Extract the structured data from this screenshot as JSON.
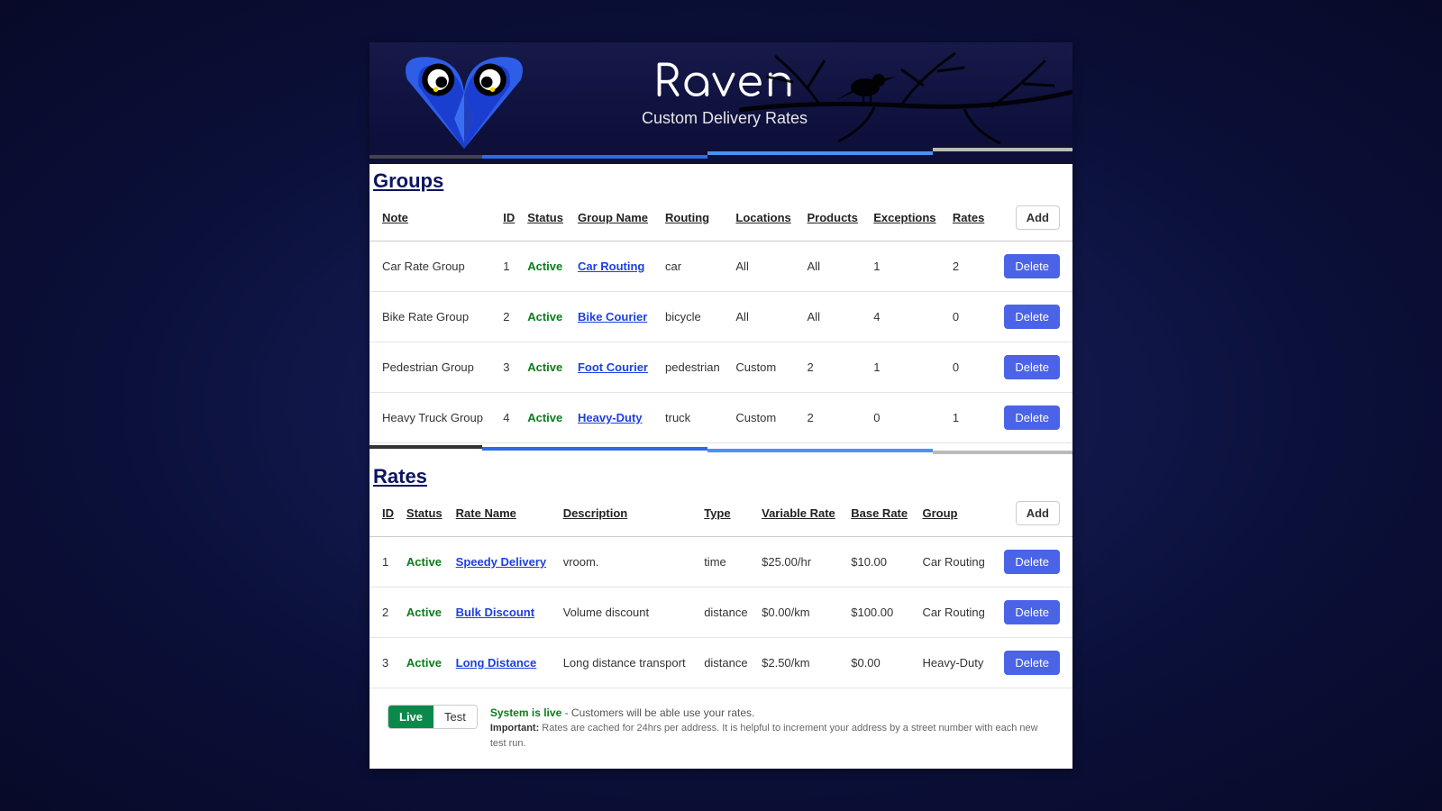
{
  "brand": {
    "name": "Raven",
    "subtitle": "Custom Delivery Rates"
  },
  "sections": {
    "groups": "Groups",
    "rates": "Rates"
  },
  "buttons": {
    "add": "Add",
    "delete": "Delete"
  },
  "groups": {
    "headers": [
      "Note",
      "ID",
      "Status",
      "Group Name",
      "Routing",
      "Locations",
      "Products",
      "Exceptions",
      "Rates",
      ""
    ],
    "rows": [
      {
        "note": "Car Rate Group",
        "id": "1",
        "status": "Active",
        "name": "Car Routing",
        "routing": "car",
        "locations": "All",
        "products": "All",
        "exceptions": "1",
        "rates": "2"
      },
      {
        "note": "Bike Rate Group",
        "id": "2",
        "status": "Active",
        "name": "Bike Courier",
        "routing": "bicycle",
        "locations": "All",
        "products": "All",
        "exceptions": "4",
        "rates": "0"
      },
      {
        "note": "Pedestrian Group",
        "id": "3",
        "status": "Active",
        "name": "Foot Courier",
        "routing": "pedestrian",
        "locations": "Custom",
        "products": "2",
        "exceptions": "1",
        "rates": "0"
      },
      {
        "note": "Heavy Truck Group",
        "id": "4",
        "status": "Active",
        "name": "Heavy-Duty",
        "routing": "truck",
        "locations": "Custom",
        "products": "2",
        "exceptions": "0",
        "rates": "1"
      }
    ]
  },
  "ratesTable": {
    "headers": [
      "ID",
      "Status",
      "Rate Name",
      "Description",
      "Type",
      "Variable Rate",
      "Base Rate",
      "Group",
      ""
    ],
    "rows": [
      {
        "id": "1",
        "status": "Active",
        "name": "Speedy Delivery",
        "desc": "vroom.",
        "type": "time",
        "variable": "$25.00/hr",
        "base": "$10.00",
        "group": "Car Routing"
      },
      {
        "id": "2",
        "status": "Active",
        "name": "Bulk Discount",
        "desc": "Volume discount",
        "type": "distance",
        "variable": "$0.00/km",
        "base": "$100.00",
        "group": "Car Routing"
      },
      {
        "id": "3",
        "status": "Active",
        "name": "Long Distance",
        "desc": "Long distance transport",
        "type": "distance",
        "variable": "$2.50/km",
        "base": "$0.00",
        "group": "Heavy-Duty"
      }
    ]
  },
  "footer": {
    "live": "Live",
    "test": "Test",
    "headline": "System is live",
    "sub": " - Customers will be able use your rates.",
    "importantLabel": "Important:",
    "important": " Rates are cached for 24hrs per address. It is helpful to increment your address by a street number with each new test run."
  }
}
